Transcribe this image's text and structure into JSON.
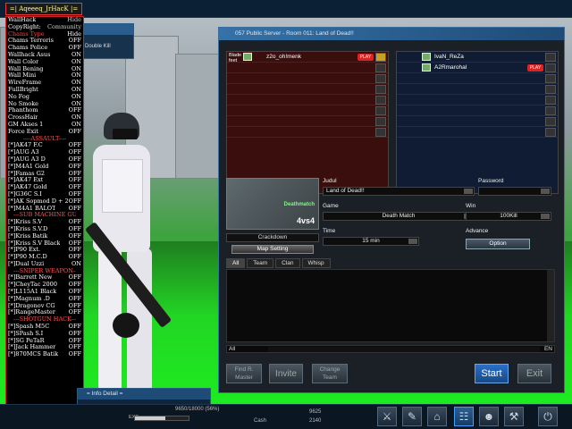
{
  "hack_menu": {
    "title": "=| Aqeeeq_JrHacK |=",
    "items": [
      {
        "name": "WallHack",
        "value": "Hide",
        "kind": "top"
      },
      {
        "name": "CopyRight:",
        "value": "Community",
        "kind": "top"
      },
      {
        "name": "Chams Type",
        "value": "Hide",
        "kind": "red"
      },
      {
        "name": "Chams Terroris",
        "value": "OFF"
      },
      {
        "name": "Chams Police",
        "value": "OFF"
      },
      {
        "name": "Wallhack Asus",
        "value": "ON"
      },
      {
        "name": "Wall Color",
        "value": "ON"
      },
      {
        "name": "Wall Bening",
        "value": "ON"
      },
      {
        "name": "Wall Mini",
        "value": "ON"
      },
      {
        "name": "WireFrame",
        "value": "ON"
      },
      {
        "name": "FullBright",
        "value": "ON"
      },
      {
        "name": "No Fog",
        "value": "ON"
      },
      {
        "name": "No Smoke",
        "value": "ON"
      },
      {
        "name": "Phanthom",
        "value": "OFF"
      },
      {
        "name": "CrossHair",
        "value": "ON"
      },
      {
        "name": "GM Akses 1",
        "value": "ON"
      },
      {
        "name": "Force Exit",
        "value": "OFF"
      },
      {
        "name": "----ASSAULT----",
        "value": "",
        "kind": "sec"
      },
      {
        "name": "[*]AK47 F.C",
        "value": "OFF"
      },
      {
        "name": "[*]AUG A3",
        "value": "OFF"
      },
      {
        "name": "[*]AUG A3 D",
        "value": "OFF"
      },
      {
        "name": "[*]M4A1 Gold",
        "value": "OFF"
      },
      {
        "name": "[*]Famas G2",
        "value": "OFF"
      },
      {
        "name": "[*]AK47 Ext",
        "value": "OFF"
      },
      {
        "name": "[*]AK47 Gold",
        "value": "OFF"
      },
      {
        "name": "[*]G36C S.I",
        "value": "OFF"
      },
      {
        "name": "[*]AK Sopmod D + 20%",
        "value": "OFF"
      },
      {
        "name": "[*]M4A1 BALOT",
        "value": "OFF"
      },
      {
        "name": "---SUB MACHINE GUN---",
        "value": "",
        "kind": "sec"
      },
      {
        "name": "[*]Kriss S.V",
        "value": "OFF"
      },
      {
        "name": "[*]Kriss S.V.D",
        "value": "OFF"
      },
      {
        "name": "[*]Kriss Batik",
        "value": "OFF"
      },
      {
        "name": "[*]Kriss S.V Black",
        "value": "OFF"
      },
      {
        "name": "[*]P90 Ext.",
        "value": "OFF"
      },
      {
        "name": "[*]P90 M.C.D",
        "value": "OFF"
      },
      {
        "name": "[*]Dual Uzzi",
        "value": "ON"
      },
      {
        "name": "---SNIPER WEAPON---",
        "value": "",
        "kind": "sec"
      },
      {
        "name": "[*]Barrett New",
        "value": "OFF"
      },
      {
        "name": "[*]CheyTac 2000",
        "value": "OFF"
      },
      {
        "name": "[*]L115A1 Black",
        "value": "OFF"
      },
      {
        "name": "[*]Magnum .D",
        "value": "OFF"
      },
      {
        "name": "[*]Dragonov CG",
        "value": "OFF"
      },
      {
        "name": "[*]RangeMaster",
        "value": "OFF"
      },
      {
        "name": "---SHOTGUN HACK---",
        "value": "",
        "kind": "sec"
      },
      {
        "name": "[*]Spash M5C",
        "value": "OFF"
      },
      {
        "name": "[*]SPash S.I",
        "value": "OFF"
      },
      {
        "name": "[*]SG PeTaR",
        "value": "OFF"
      },
      {
        "name": "[*]Jack Hammer",
        "value": "OFF"
      },
      {
        "name": "[*]870MCS Batik",
        "value": "OFF"
      }
    ]
  },
  "behind_panel": {
    "text": "Double Kill"
  },
  "room": {
    "title": "057 Public Server - Room 011: Land of Dead!!",
    "red_team": {
      "players": [
        {
          "label": "Blade feet",
          "nick": "z2o_oh!menk",
          "tag": "PLAY"
        }
      ]
    },
    "blue_team": {
      "players": [
        {
          "nick": "IvaN_ReZa",
          "tag": ""
        },
        {
          "nick": "A2Rmarohal",
          "tag": "PLAY"
        }
      ]
    },
    "map": {
      "vs": "4vs4",
      "label": "Deathmatch",
      "name": "Crackdown",
      "setting_btn": "Map Setting"
    },
    "fields": {
      "judul_label": "Judul",
      "judul_value": "Land of Dead!!",
      "password_label": "Password",
      "password_value": "",
      "game_label": "Game",
      "game_value": "Death Match",
      "win_label": "Win",
      "win_value": "100Kill",
      "time_label": "Time",
      "time_value": "15 min",
      "advance_label": "Advance",
      "option_btn": "Option"
    },
    "chat": {
      "tabs": [
        "All",
        "Team",
        "Clan",
        "Whisp"
      ],
      "target": "All",
      "lang": "EN"
    },
    "buttons": {
      "find_master": "Find R. Master",
      "invite": "Invite",
      "change_team": "Change Team",
      "start": "Start",
      "exit": "Exit"
    }
  },
  "info_panel": {
    "title": "= Info Detail ="
  },
  "taskbar": {
    "exp_label": "EXP",
    "exp_value": "9650/18000 (56%)",
    "exp_fraction": 0.56,
    "points_value": "9625",
    "cash_label": "Cash",
    "cash_value": "2140",
    "icons": [
      "inventory-icon",
      "mission-icon",
      "shop-icon",
      "cart-icon",
      "community-icon",
      "settings-icon",
      "power-icon"
    ]
  },
  "colors": {
    "accent": "#3fa0ff",
    "red_team": "#3b0e0e",
    "blue_team": "#0f1c33"
  }
}
